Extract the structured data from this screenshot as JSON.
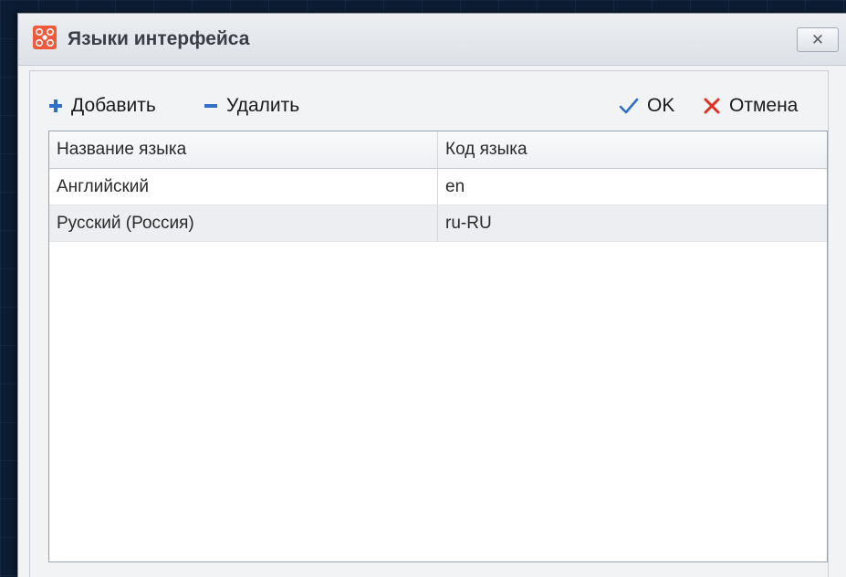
{
  "dialog": {
    "title": "Языки интерфейса",
    "close_label": "✕",
    "icon": "app-logo-icon"
  },
  "toolbar": {
    "add_label": "Добавить",
    "delete_label": "Удалить",
    "ok_label": "OK",
    "cancel_label": "Отмена",
    "icons": {
      "add": "plus-icon",
      "delete": "minus-icon",
      "ok": "checkmark-icon",
      "cancel": "cross-icon"
    }
  },
  "grid": {
    "columns": [
      "Название языка",
      "Код языка"
    ],
    "rows": [
      [
        "Английский",
        "en"
      ],
      [
        "Русский (Россия)",
        "ru-RU"
      ]
    ]
  },
  "colors": {
    "accent_add": "#2f6fc8",
    "accent_ok": "#2f6fc8",
    "accent_cancel": "#e0301e",
    "app_icon": "#ef5a3c"
  }
}
